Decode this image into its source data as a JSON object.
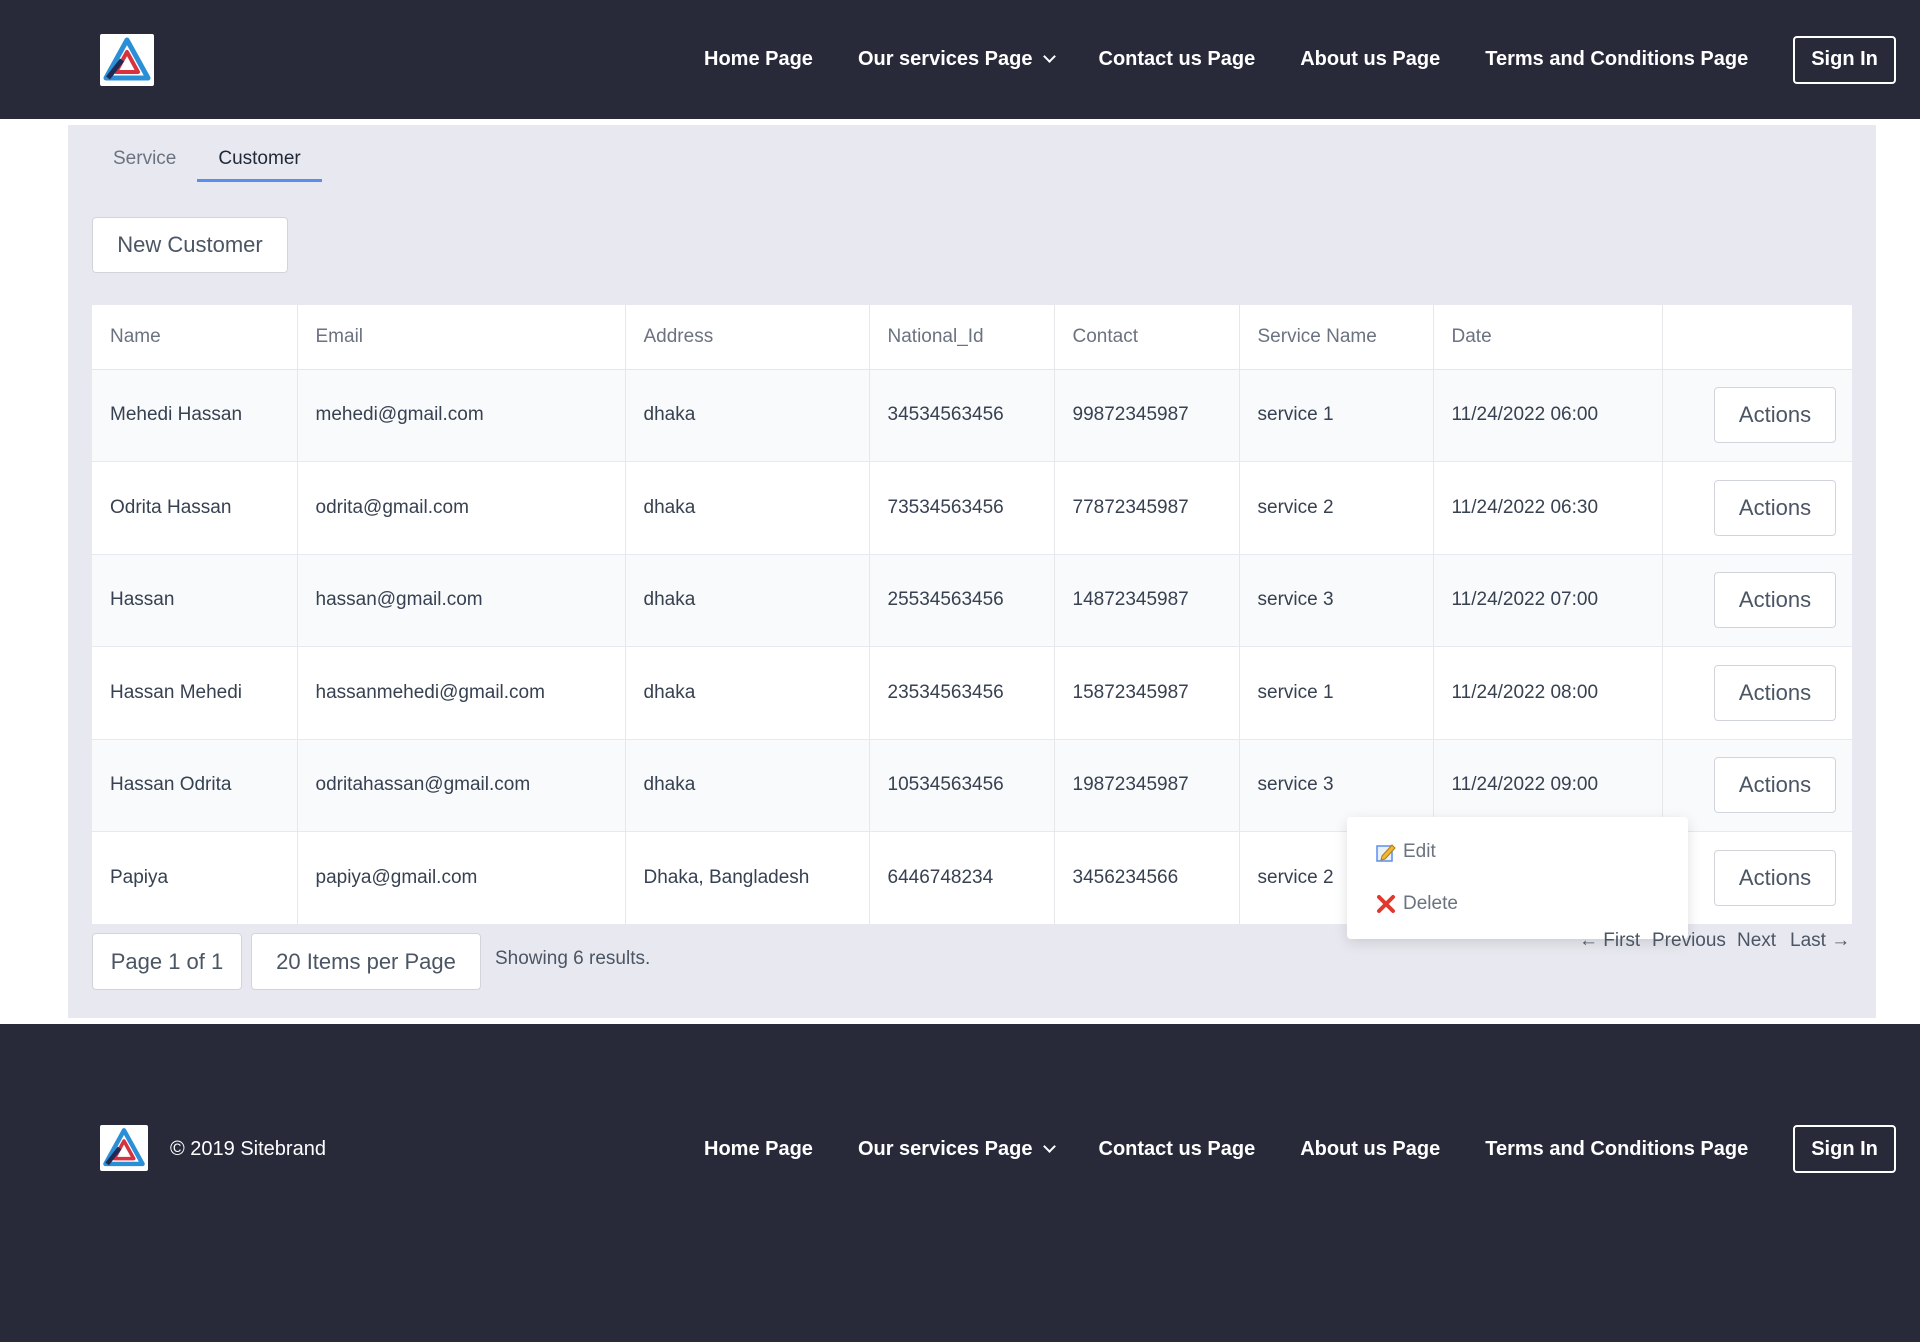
{
  "header": {
    "nav": [
      "Home Page",
      "Our services Page",
      "Contact us Page",
      "About us Page",
      "Terms and Conditions Page"
    ],
    "signin": "Sign In"
  },
  "tabs": [
    "Service",
    "Customer"
  ],
  "active_tab": "Customer",
  "new_button": "New Customer",
  "table": {
    "columns": [
      "Name",
      "Email",
      "Address",
      "National_Id",
      "Contact",
      "Service Name",
      "Date",
      ""
    ],
    "rows": [
      [
        "Mehedi Hassan",
        "mehedi@gmail.com",
        "dhaka",
        "34534563456",
        "99872345987",
        "service 1",
        "11/24/2022 06:00"
      ],
      [
        "Odrita Hassan",
        "odrita@gmail.com",
        "dhaka",
        "73534563456",
        "77872345987",
        "service 2",
        "11/24/2022 06:30"
      ],
      [
        "Hassan",
        "hassan@gmail.com",
        "dhaka",
        "25534563456",
        "14872345987",
        "service 3",
        "11/24/2022 07:00"
      ],
      [
        "Hassan Mehedi",
        "hassanmehedi@gmail.com",
        "dhaka",
        "23534563456",
        "15872345987",
        "service 1",
        "11/24/2022 08:00"
      ],
      [
        "Hassan Odrita",
        "odritahassan@gmail.com",
        "dhaka",
        "10534563456",
        "19872345987",
        "service 3",
        "11/24/2022 09:00"
      ],
      [
        "Papiya",
        "papiya@gmail.com",
        "Dhaka, Bangladesh",
        "6446748234",
        "3456234566",
        "service 2",
        ""
      ]
    ],
    "actions_label": "Actions"
  },
  "dropdown": {
    "edit": "Edit",
    "delete": "Delete",
    "edit_icon": "edit-icon",
    "delete_icon": "delete-icon"
  },
  "pagination": {
    "page": "Page 1 of 1",
    "per_page": "20 Items per Page",
    "showing": "Showing 6 results.",
    "first": "← First",
    "previous": "Previous",
    "next": "Next",
    "last": "Last →"
  },
  "footer": {
    "copyright": "© 2019 Sitebrand",
    "nav": [
      "Home Page",
      "Our services Page",
      "Contact us Page",
      "About us Page",
      "Terms and Conditions Page"
    ],
    "signin": "Sign In"
  },
  "colors": {
    "dark": "#282a3a",
    "panel": "#e8e9f0",
    "tab_accent": "#5b8def"
  }
}
